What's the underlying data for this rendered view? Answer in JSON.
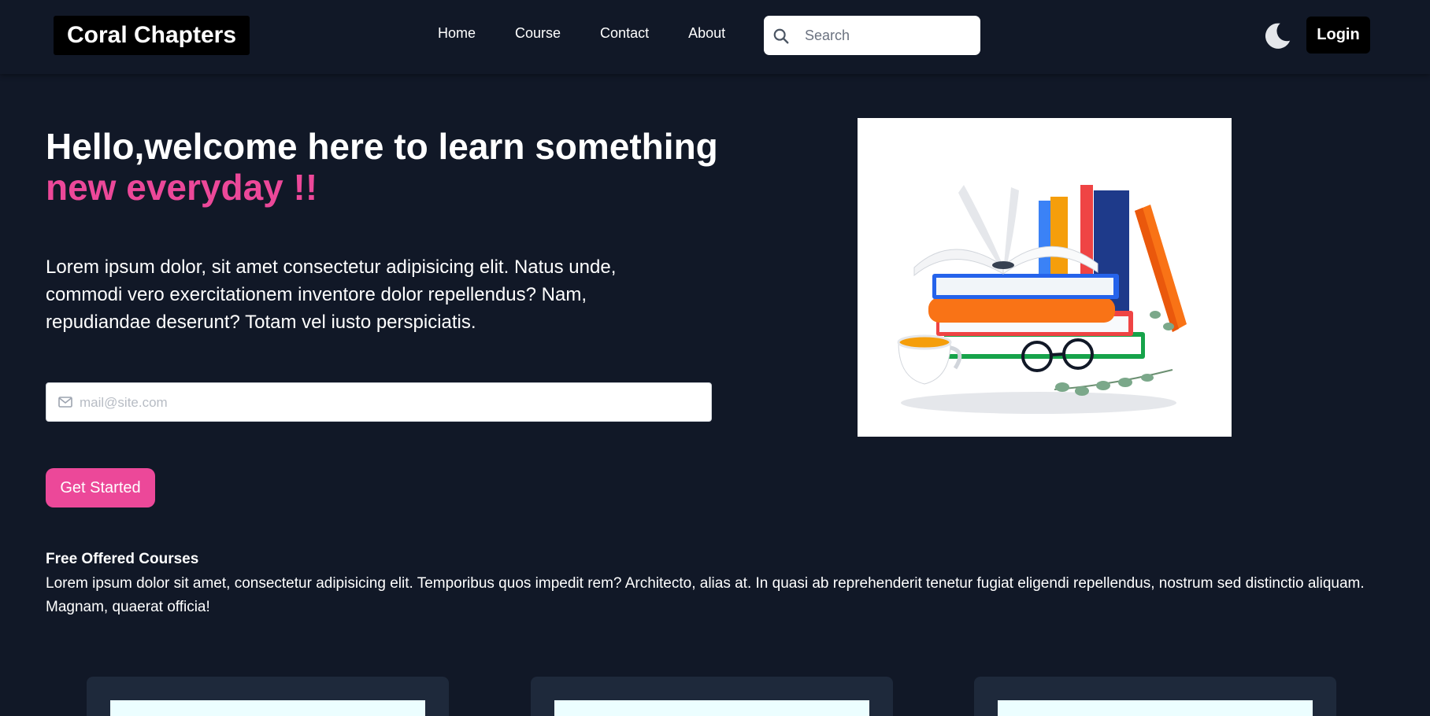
{
  "navbar": {
    "brand": "Coral Chapters",
    "links": [
      {
        "label": "Home"
      },
      {
        "label": "Course"
      },
      {
        "label": "Contact"
      },
      {
        "label": "About"
      }
    ],
    "search": {
      "placeholder": "Search",
      "value": ""
    },
    "theme_toggle_icon": "moon-icon",
    "login_label": "Login"
  },
  "hero": {
    "title_line1": "Hello,welcome here to learn something",
    "title_line2": "new everyday !!",
    "description": "Lorem ipsum dolor, sit amet consectetur adipisicing elit. Natus unde, commodi vero exercitationem inventore dolor repellendus? Nam, repudiandae deserunt? Totam vel iusto perspiciatis.",
    "email": {
      "placeholder": "mail@site.com",
      "value": "",
      "icon": "mail-icon"
    },
    "cta_label": "Get Started",
    "image_icon": "books-illustration"
  },
  "courses": {
    "heading": "Free Offered Courses",
    "description": "Lorem ipsum dolor sit amet, consectetur adipisicing elit. Temporibus quos impedit rem? Architecto, alias at. In quasi ab reprehenderit tenetur fugiat eligendi repellendus, nostrum sed distinctio aliquam. Magnam, quaerat officia!"
  },
  "colors": {
    "background": "#111827",
    "accent": "#ec4899",
    "card": "#1e293b",
    "brand_bg": "#000000"
  }
}
